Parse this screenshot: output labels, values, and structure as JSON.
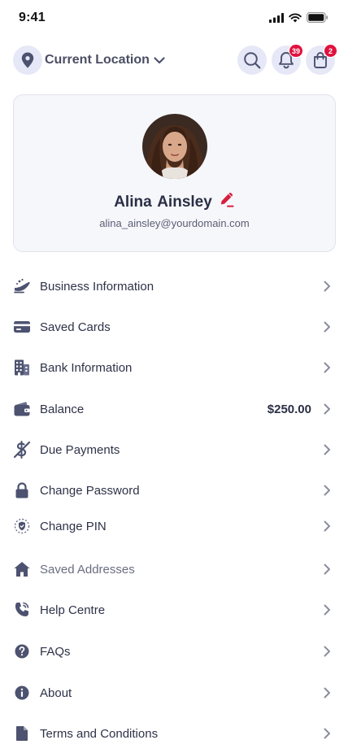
{
  "status_bar": {
    "time": "9:41"
  },
  "header": {
    "location_label": "Current Location",
    "notifications_count": "39",
    "cart_count": "2"
  },
  "profile": {
    "name": "Alina  Ainsley",
    "email": "alina_ainsley@yourdomain.com"
  },
  "menu": [
    {
      "label": "Business Information",
      "icon": "business-icon"
    },
    {
      "label": "Saved Cards",
      "icon": "card-icon"
    },
    {
      "label": "Bank Information",
      "icon": "bank-building-icon"
    },
    {
      "label": "Balance",
      "icon": "wallet-icon",
      "value": "$250.00"
    },
    {
      "label": "Due Payments",
      "icon": "no-money-icon"
    },
    {
      "label": "Change Password",
      "icon": "lock-icon"
    },
    {
      "label": "Change PIN",
      "icon": "pin-shield-icon"
    },
    {
      "label": "Saved Addresses",
      "icon": "home-icon"
    },
    {
      "label": "Help Centre",
      "icon": "phone-icon"
    },
    {
      "label": "FAQs",
      "icon": "question-icon"
    },
    {
      "label": "About",
      "icon": "info-icon"
    },
    {
      "label": "Terms and Conditions",
      "icon": "document-icon"
    }
  ],
  "colors": {
    "accent_bg": "#e6e8f7",
    "badge": "#e0123f",
    "icon": "#4d5270",
    "edit_icon": "#d81e3f"
  }
}
